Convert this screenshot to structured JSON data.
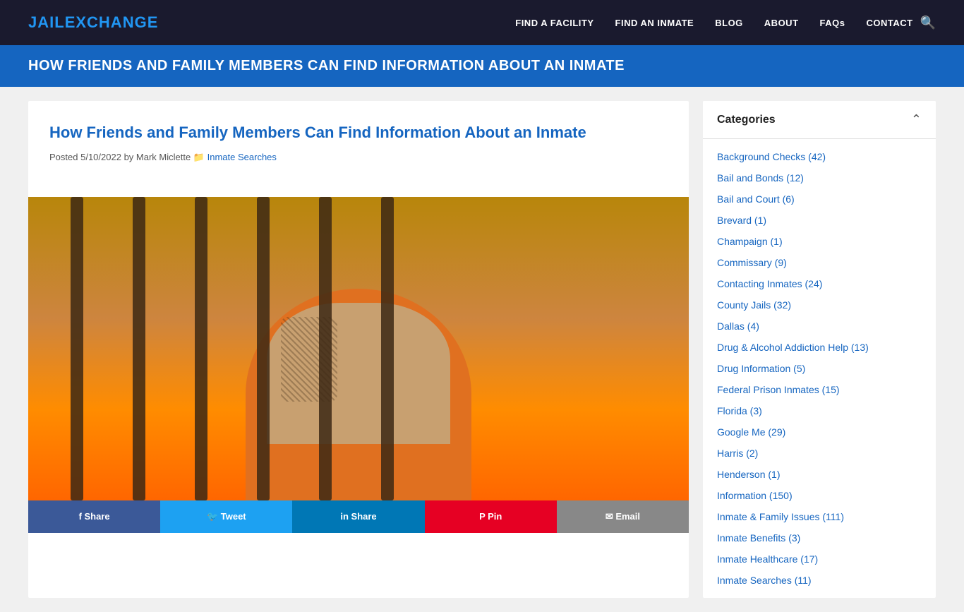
{
  "logo": {
    "part1": "JAIL",
    "part2": "EXCHANGE"
  },
  "nav": {
    "links": [
      {
        "id": "find-facility",
        "label": "FIND A FACILITY"
      },
      {
        "id": "find-inmate",
        "label": "FIND AN INMATE"
      },
      {
        "id": "blog",
        "label": "BLOG"
      },
      {
        "id": "about",
        "label": "ABOUT"
      },
      {
        "id": "faqs",
        "label": "FAQs"
      },
      {
        "id": "contact",
        "label": "CONTACT"
      }
    ]
  },
  "page_banner": {
    "title": "HOW FRIENDS AND FAMILY MEMBERS CAN FIND INFORMATION ABOUT AN INMATE"
  },
  "article": {
    "title": "How Friends and Family Members Can Find Information About an Inmate",
    "meta_posted": "Posted",
    "meta_date": "5/10/2022",
    "meta_by": "by Mark Miclette",
    "meta_category_link": "Inmate Searches"
  },
  "social": {
    "buttons": [
      {
        "id": "facebook",
        "label": "f Share",
        "class": "facebook"
      },
      {
        "id": "twitter",
        "label": "🐦 Tweet",
        "class": "twitter"
      },
      {
        "id": "linkedin",
        "label": "in Share",
        "class": "linkedin"
      },
      {
        "id": "pinterest",
        "label": "P Pin",
        "class": "pinterest"
      },
      {
        "id": "email",
        "label": "✉ Email",
        "class": "email"
      }
    ]
  },
  "sidebar": {
    "categories_title": "Categories",
    "categories": [
      {
        "label": "Background Checks (42)"
      },
      {
        "label": "Bail and Bonds (12)"
      },
      {
        "label": "Bail and Court (6)"
      },
      {
        "label": "Brevard (1)"
      },
      {
        "label": "Champaign (1)"
      },
      {
        "label": "Commissary (9)"
      },
      {
        "label": "Contacting Inmates (24)"
      },
      {
        "label": "County Jails (32)"
      },
      {
        "label": "Dallas (4)"
      },
      {
        "label": "Drug & Alcohol Addiction Help (13)"
      },
      {
        "label": "Drug Information (5)"
      },
      {
        "label": "Federal Prison Inmates (15)"
      },
      {
        "label": "Florida (3)"
      },
      {
        "label": "Google Me (29)"
      },
      {
        "label": "Harris (2)"
      },
      {
        "label": "Henderson (1)"
      },
      {
        "label": "Information (150)"
      },
      {
        "label": "Inmate & Family Issues (111)"
      },
      {
        "label": "Inmate Benefits (3)"
      },
      {
        "label": "Inmate Healthcare (17)"
      },
      {
        "label": "Inmate Searches (11)"
      }
    ]
  }
}
